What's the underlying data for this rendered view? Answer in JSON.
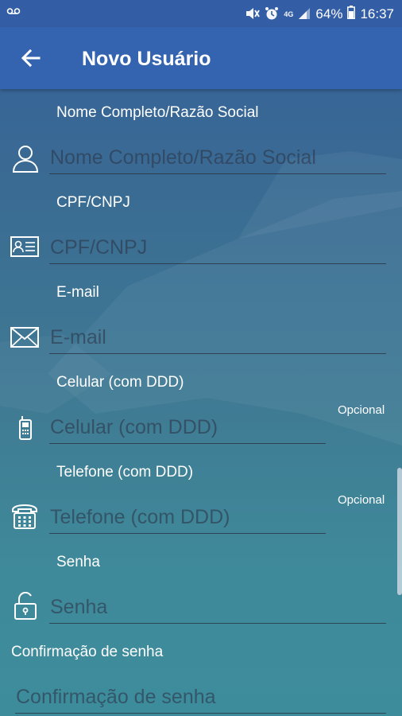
{
  "statusbar": {
    "left_icon": "voicemail-icon",
    "icons": [
      "mute-icon",
      "alarm-icon",
      "4g-icon",
      "signal-icon"
    ],
    "battery": "64%",
    "time": "16:37"
  },
  "appbar": {
    "title": "Novo Usuário",
    "back_icon": "back-arrow-icon"
  },
  "form": {
    "name": {
      "label": "Nome Completo/Razão Social",
      "placeholder": "Nome Completo/Razão Social",
      "value": "",
      "icon": "user-icon"
    },
    "cpf": {
      "label": "CPF/CNPJ",
      "placeholder": "CPF/CNPJ",
      "value": "",
      "icon": "id-card-icon"
    },
    "email": {
      "label": "E-mail",
      "placeholder": "E-mail",
      "value": "",
      "icon": "envelope-icon"
    },
    "mobile": {
      "label": "Celular (com DDD)",
      "placeholder": "Celular (com DDD)",
      "value": "",
      "icon": "mobile-phone-icon",
      "optional": "Opcional"
    },
    "phone": {
      "label": "Telefone (com DDD)",
      "placeholder": "Telefone (com DDD)",
      "value": "",
      "icon": "desk-phone-icon",
      "optional": "Opcional"
    },
    "password": {
      "label": "Senha",
      "placeholder": "Senha",
      "value": "",
      "icon": "lock-icon"
    },
    "confirm": {
      "label": "Confirmação de senha",
      "placeholder": "Confirmação de senha",
      "value": ""
    }
  },
  "colors": {
    "statusbar": "#335ea6",
    "appbar": "#3464b0",
    "text": "#ffffff"
  }
}
